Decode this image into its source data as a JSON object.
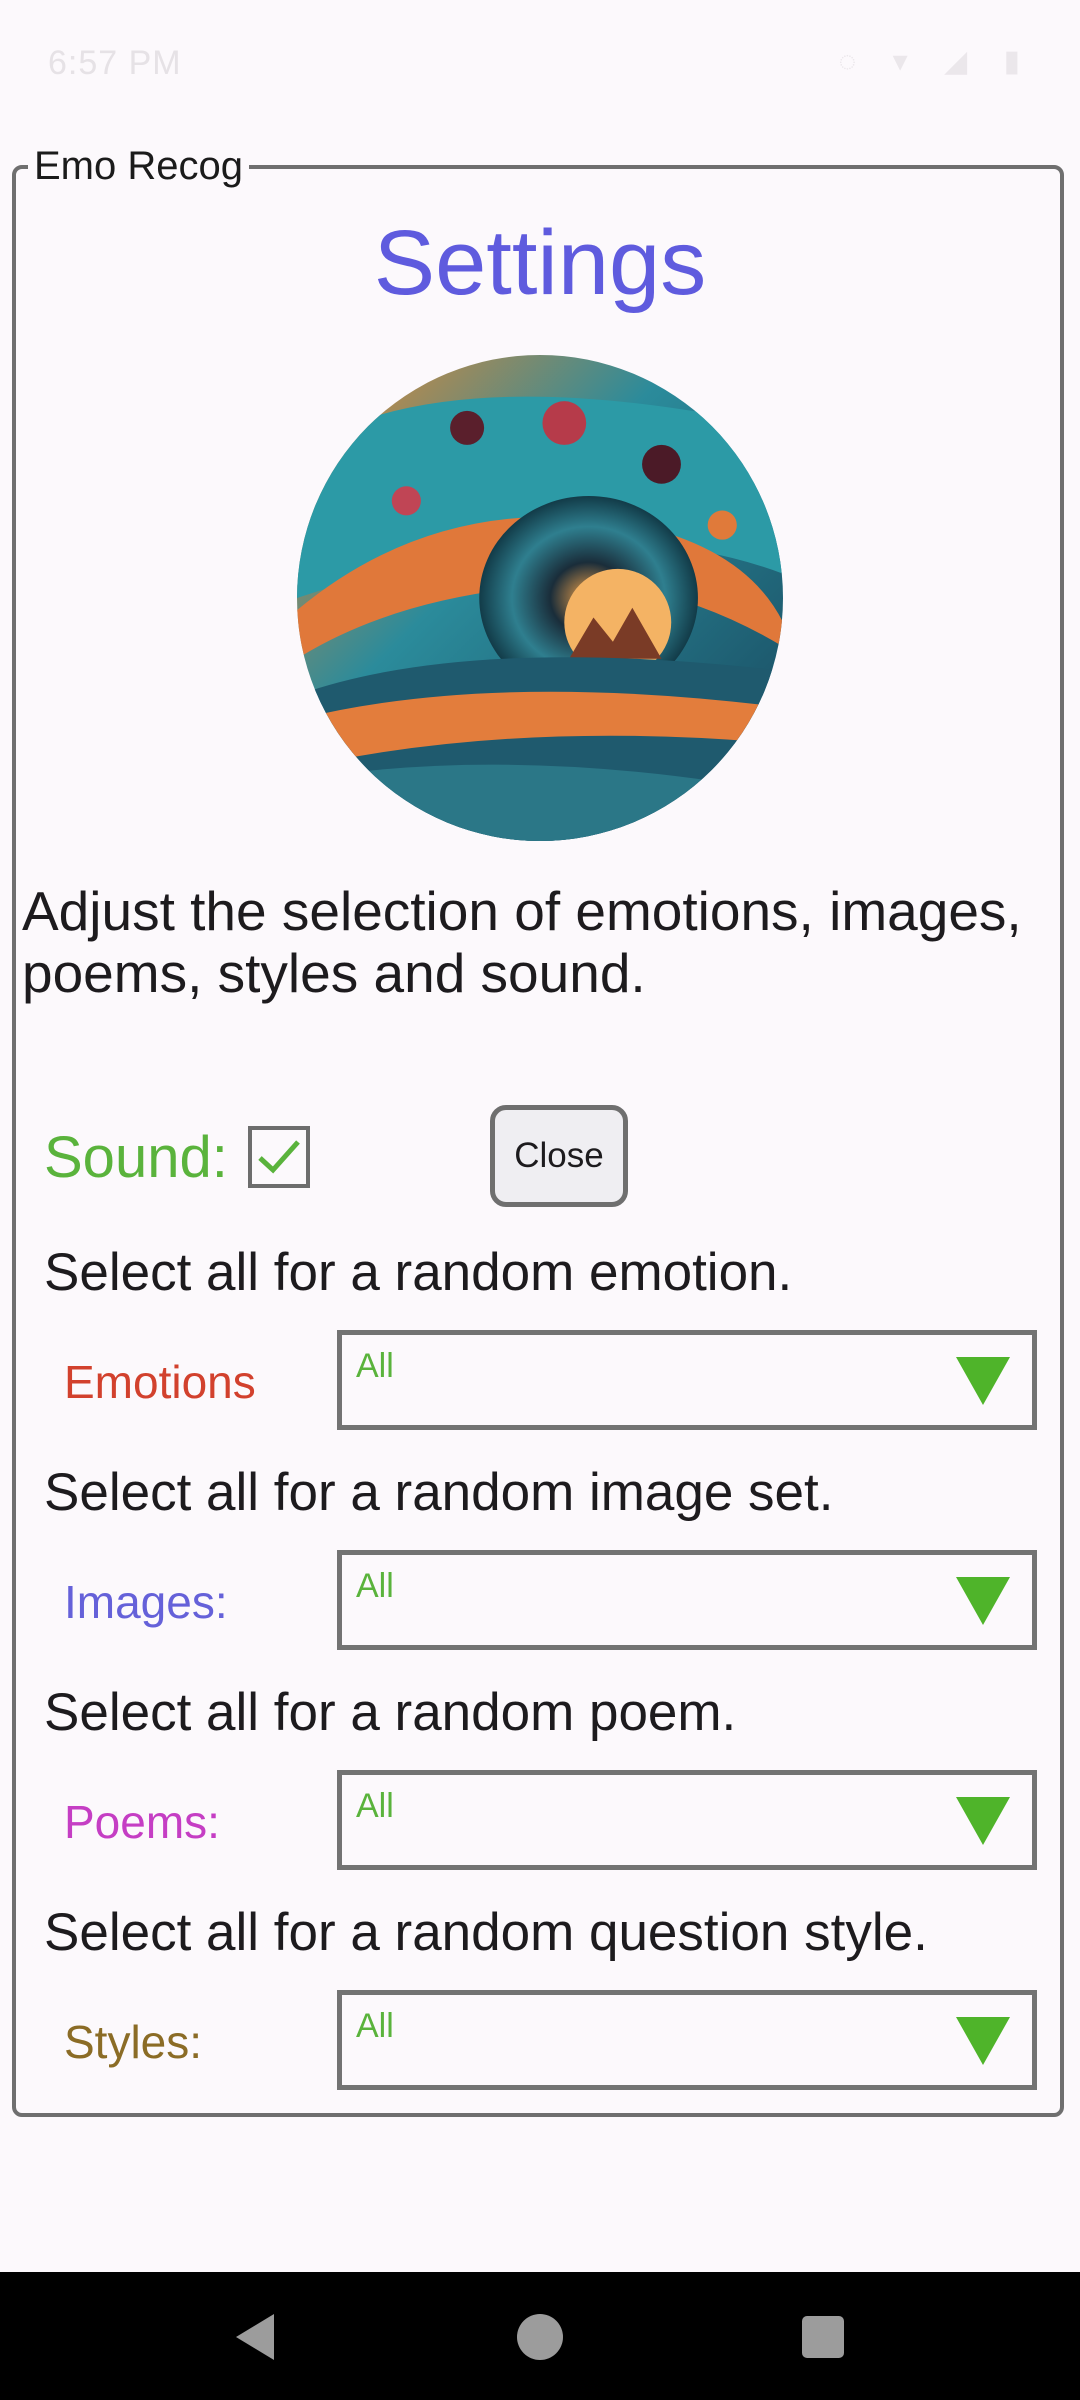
{
  "status_bar": {
    "time": "6:57 PM",
    "icons": "◌ ▾ ◢ ▮"
  },
  "dialog": {
    "legend": "Emo Recog",
    "title": "Settings"
  },
  "intro_text": "Adjust the selection of emotions, images, poems, styles and sound.",
  "sound": {
    "label": "Sound:",
    "checked": true
  },
  "close_label": "Close",
  "sections": {
    "emotions": {
      "hint": "Select all for a random emotion.",
      "label": "Emotions",
      "value": "All",
      "color": "#d2412d"
    },
    "images": {
      "hint": "Select all for a random image set.",
      "label": "Images:",
      "value": "All",
      "color": "#6561d9"
    },
    "poems": {
      "hint": "Select all for a random poem.",
      "label": "Poems:",
      "value": "All",
      "color": "#c53ec4"
    },
    "styles": {
      "hint": "Select all for a random question style.",
      "label": "Styles:",
      "value": "All",
      "color": "#8b6c26"
    }
  },
  "colors": {
    "accent_green": "#5ab33c",
    "title_purple": "#5f5bde",
    "arrow_green": "#4fb42a"
  },
  "icons": {
    "checkbox": "check-icon",
    "dropdown": "triangle-down-icon",
    "nav": [
      "back-icon",
      "home-icon",
      "recents-icon"
    ]
  }
}
